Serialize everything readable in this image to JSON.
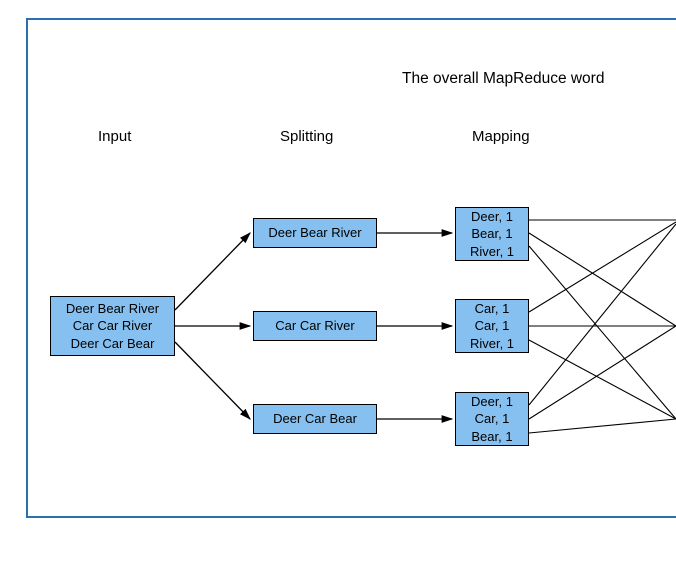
{
  "title": "The overall MapReduce word",
  "stages": {
    "input": "Input",
    "splitting": "Splitting",
    "mapping": "Mapping"
  },
  "inputBox": {
    "line1": "Deer Bear River",
    "line2": "Car Car River",
    "line3": "Deer Car Bear"
  },
  "splitBoxes": [
    "Deer Bear River",
    "Car Car River",
    "Deer Car Bear"
  ],
  "mapBoxes": [
    {
      "l1": "Deer, 1",
      "l2": "Bear, 1",
      "l3": "River, 1"
    },
    {
      "l1": "Car, 1",
      "l2": "Car, 1",
      "l3": "River, 1"
    },
    {
      "l1": "Deer, 1",
      "l2": "Car, 1",
      "l3": "Bear, 1"
    }
  ]
}
